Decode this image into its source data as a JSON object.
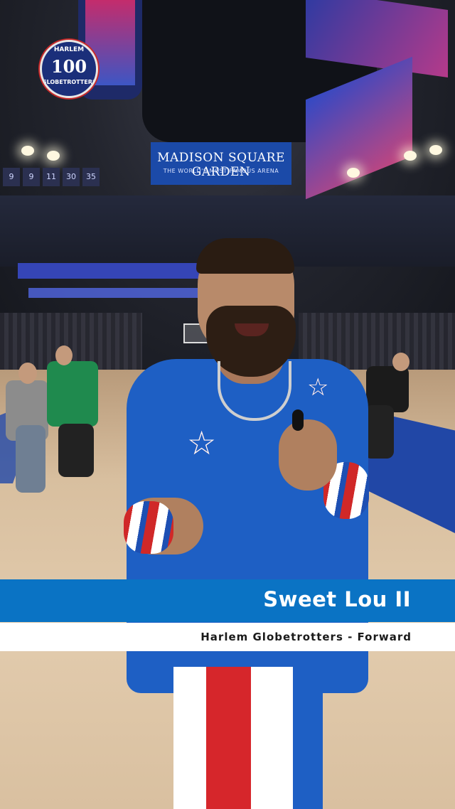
{
  "scene": {
    "venue_banner": {
      "title": "MADISON SQUARE GARDEN",
      "subtitle": "THE WORLD'S MOST FAMOUS ARENA"
    },
    "retired_numbers": [
      "9",
      "9",
      "11",
      "30",
      "35"
    ],
    "logo": {
      "top_text": "HARLEM",
      "number": "100",
      "bottom_text": "GLOBETROTTERS"
    }
  },
  "lower_third": {
    "name": "Sweet Lou II",
    "role": "Harlem Globetrotters - Forward",
    "bar_color": "#0a73c4"
  }
}
